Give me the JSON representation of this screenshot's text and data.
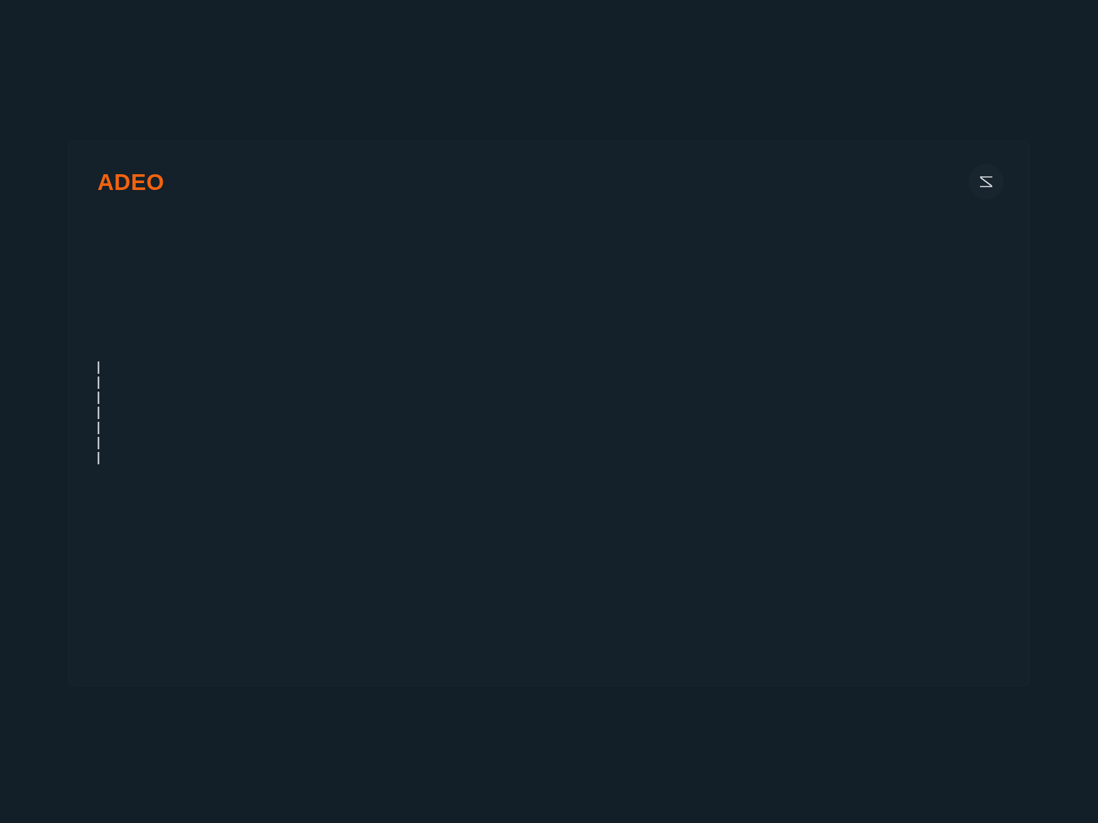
{
  "header": {
    "logo": "ADEO"
  }
}
